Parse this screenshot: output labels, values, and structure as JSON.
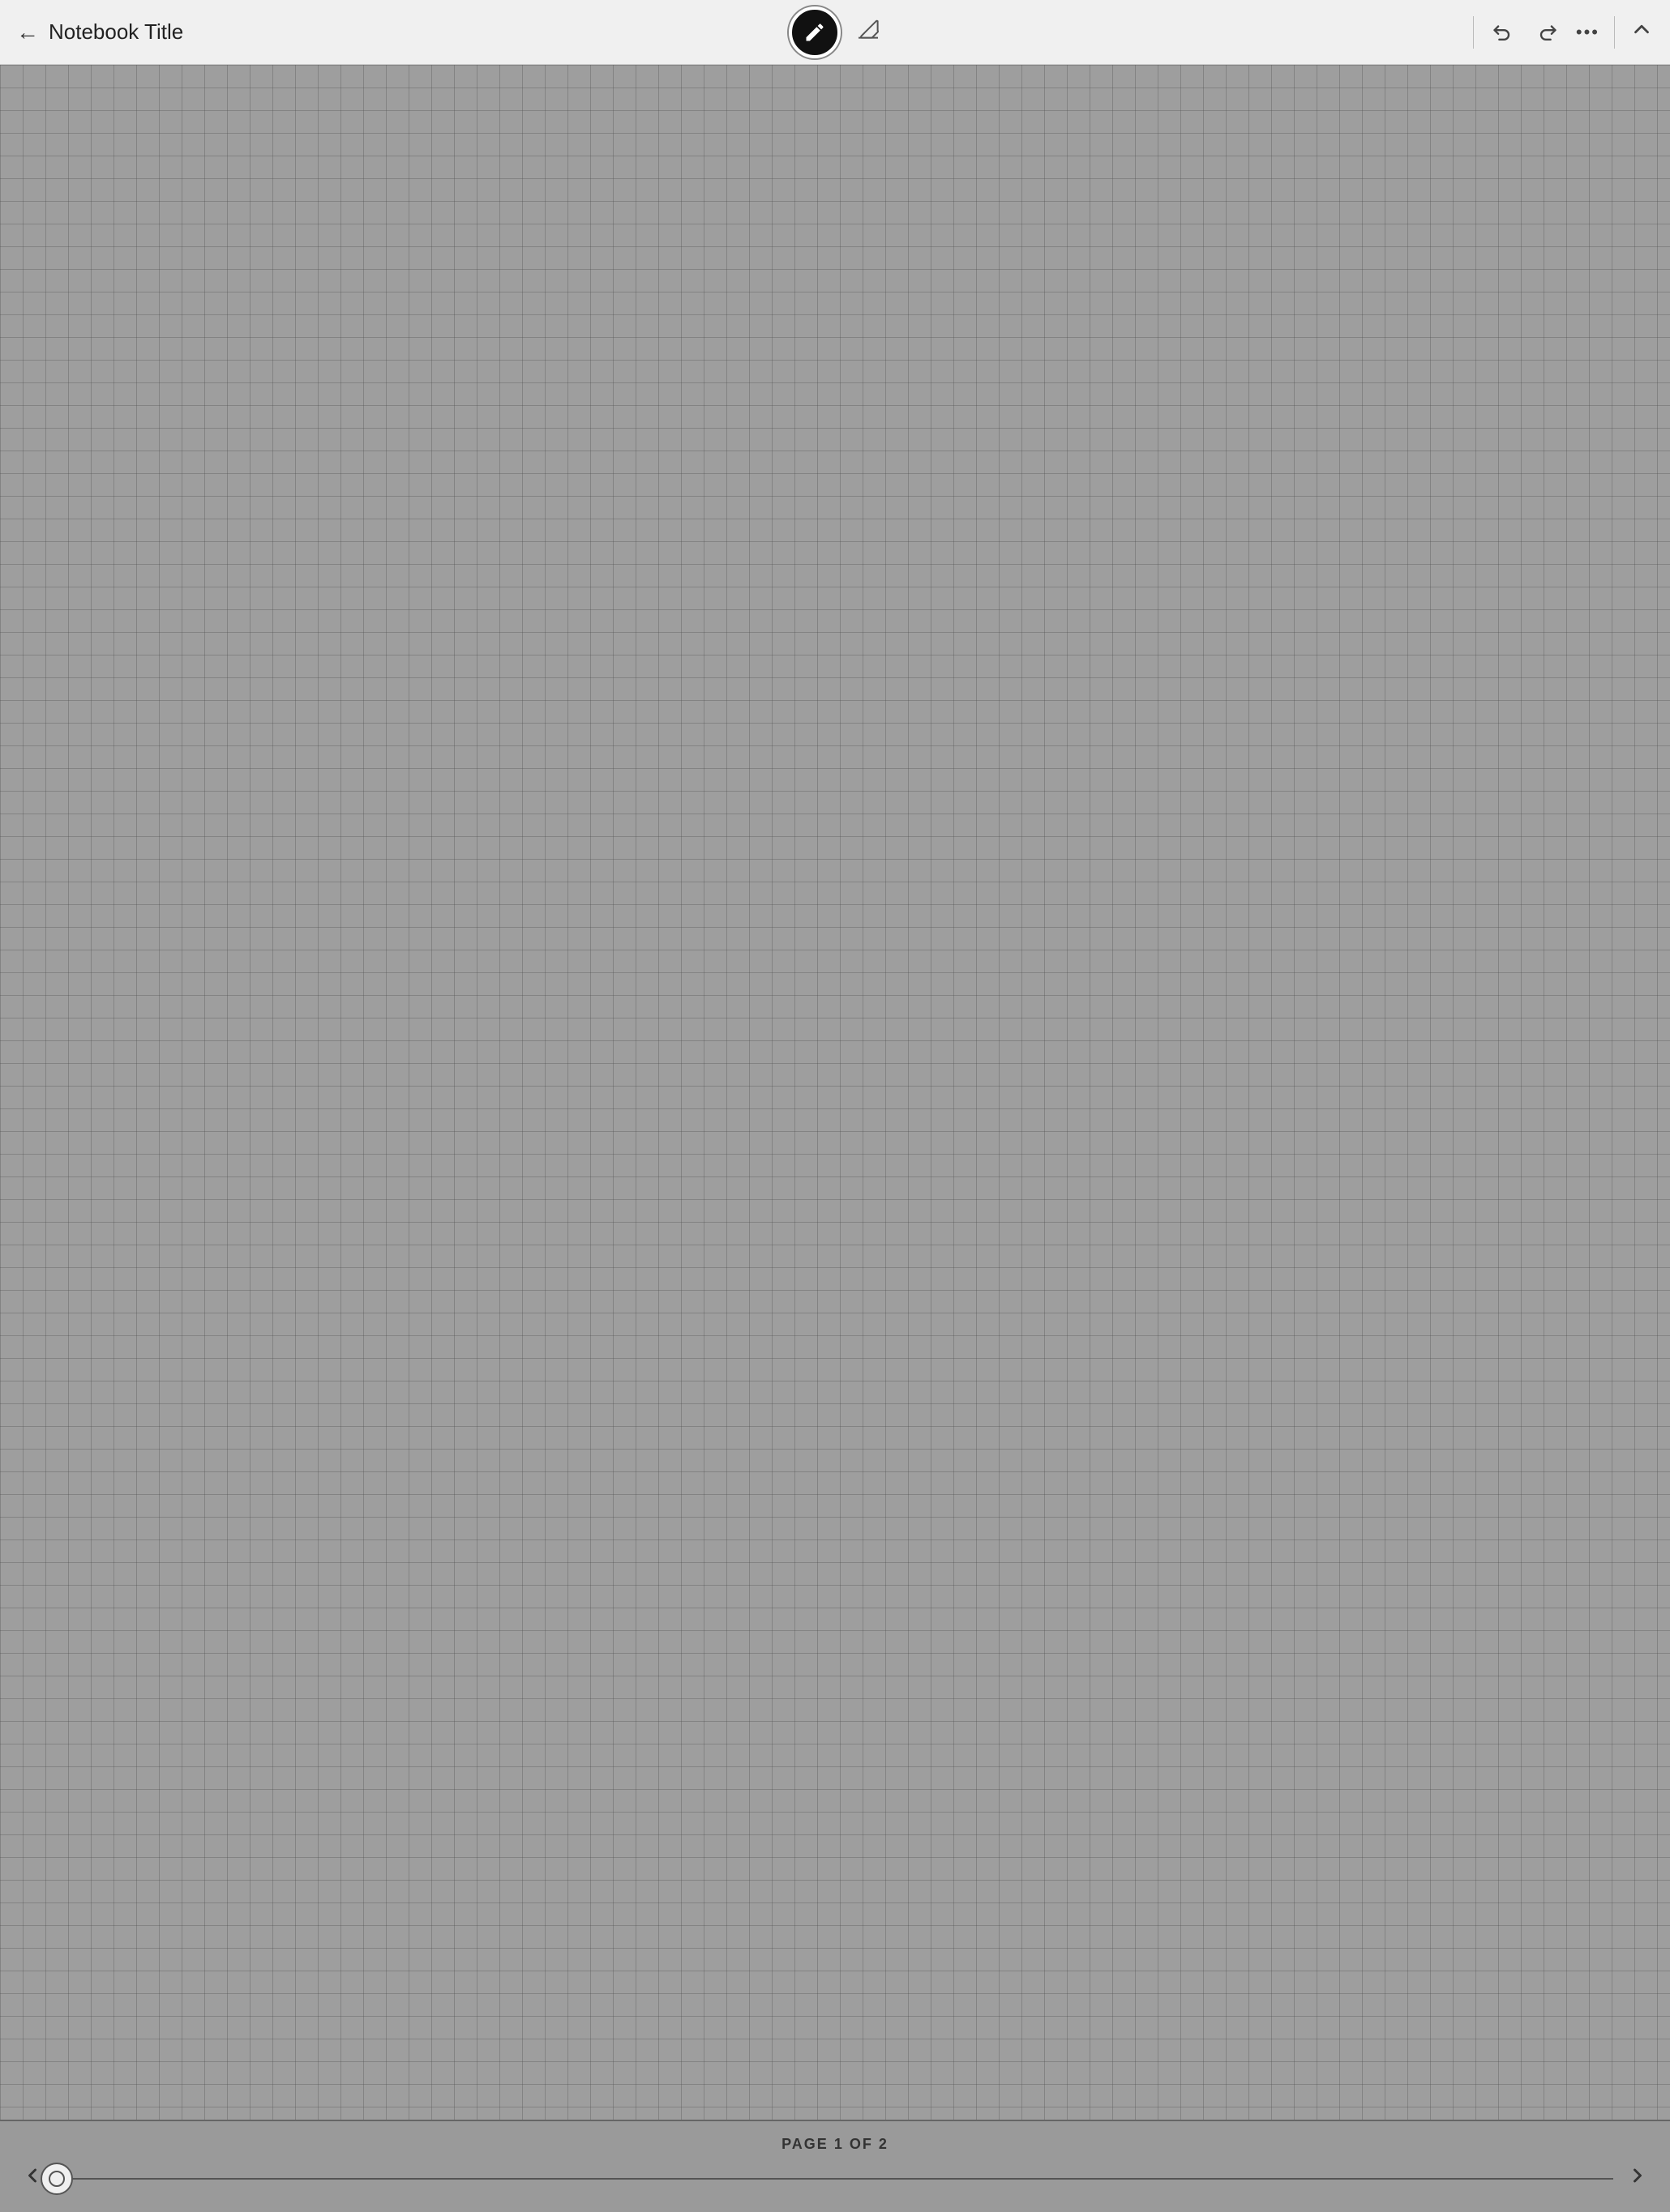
{
  "toolbar": {
    "back_label": "←",
    "title": "Notebook Title",
    "pen_icon": "✏",
    "eraser_icon": "◇",
    "undo_icon": "←",
    "redo_icon": "→",
    "more_icon": "•••",
    "chevron_up_icon": "∧"
  },
  "page_indicator": {
    "text": "PAGE 1 OF 2"
  },
  "scrubber": {
    "prev_icon": "<",
    "next_icon": ">"
  }
}
